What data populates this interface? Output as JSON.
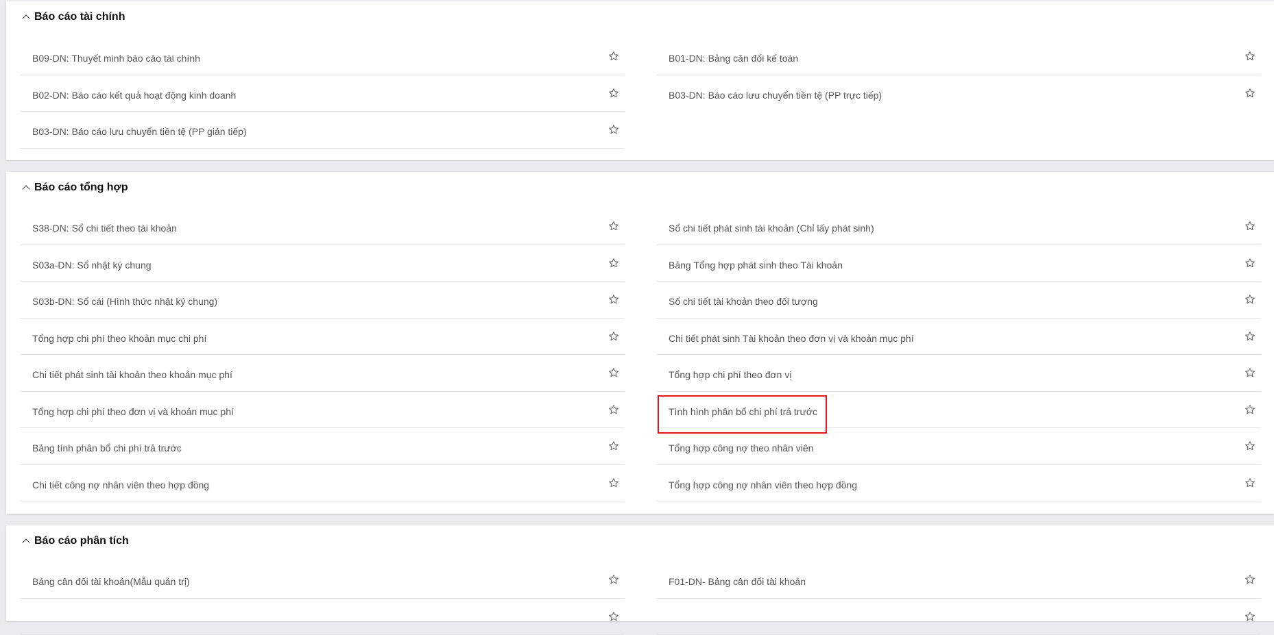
{
  "sections": [
    {
      "title": "Báo cáo tài chính",
      "left": [
        "B09-DN: Thuyết minh báo cáo tài chính",
        "B02-DN: Báo cáo kết quả hoạt động kinh doanh",
        "B03-DN: Báo cáo lưu chuyển tiền tệ (PP gián tiếp)"
      ],
      "right": [
        "B01-DN: Bảng cân đối kế toán",
        "B03-DN: Báo cáo lưu chuyển tiền tệ (PP trực tiếp)"
      ]
    },
    {
      "title": "Báo cáo tổng hợp",
      "left": [
        "S38-DN: Sổ chi tiết theo tài khoản",
        "S03a-DN: Sổ nhật ký chung",
        "S03b-DN: Sổ cái (Hình thức nhật ký chung)",
        "Tổng hợp chi phí theo khoản mục chi phí",
        "Chi tiết phát sinh tài khoản theo khoản mục phí",
        "Tổng hợp chi phí theo đơn vị và khoản mục phí",
        "Bảng tính phân bổ chi phí trả trước",
        "Chi tiết công nợ nhân viên theo hợp đồng"
      ],
      "right": [
        "Sổ chi tiết phát sinh tài khoản (Chỉ lấy phát sinh)",
        "Bảng Tổng hợp phát sinh theo Tài khoản",
        "Sổ chi tiết tài khoản theo đối tượng",
        "Chi tiết phát sinh Tài khoản theo đơn vị và khoản mục phí",
        "Tổng hợp chi phí theo đơn vị",
        "Tình hình phân bổ chi phí trả trước",
        "Tổng hợp công nợ theo nhân viên",
        "Tổng hợp công nợ nhân viên theo hợp đồng"
      ]
    },
    {
      "title": "Báo cáo phân tích",
      "left": [
        "Bảng cân đối tài khoản(Mẫu quản trị)",
        ""
      ],
      "right": [
        "F01-DN- Bảng cân đối tài khoản",
        ""
      ]
    }
  ],
  "colors": {
    "highlight": "#e5141b",
    "divider": "#dfe3e8"
  },
  "icons": {
    "header": "chevron-up-icon",
    "item": "star-outline-icon"
  }
}
